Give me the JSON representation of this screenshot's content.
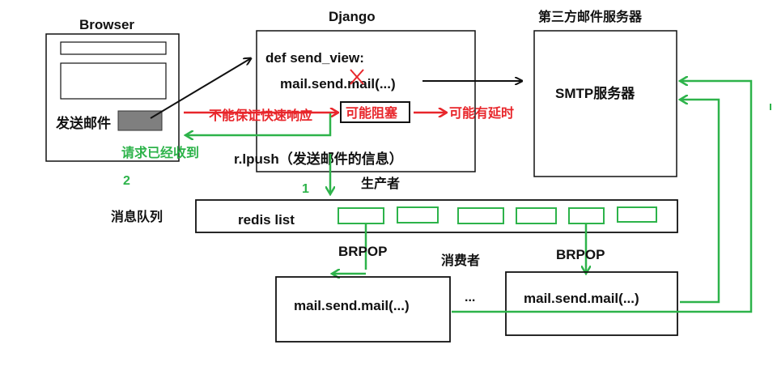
{
  "browser": {
    "title": "Browser",
    "send_label": "发送邮件"
  },
  "django": {
    "title": "Django",
    "def_line": "def send_view:",
    "call_line": "mail.send.mail(...)",
    "lpush_line": "r.lpush（发送邮件的信息）"
  },
  "smtp": {
    "title": "第三方邮件服务器",
    "label": "SMTP服务器"
  },
  "queue": {
    "label": "消息队列",
    "redis_label": "redis list",
    "producer_label": "生产者"
  },
  "consumers": {
    "label": "消费者",
    "brpop_left": "BRPOP",
    "brpop_right": "BRPOP",
    "worker_left": "mail.send.mail(...)",
    "worker_right": "mail.send.mail(...)",
    "ellipsis": "..."
  },
  "annotations": {
    "cannot_guarantee": "不能保证快速响应",
    "may_block": "可能阻塞",
    "may_delay": "可能有延时",
    "request_received": "请求已经收到",
    "step_1": "1",
    "step_2": "2"
  },
  "colors": {
    "red": "#e8262b",
    "green": "#2db34a",
    "black": "#111111",
    "gray_button": "#7f7f7f"
  }
}
